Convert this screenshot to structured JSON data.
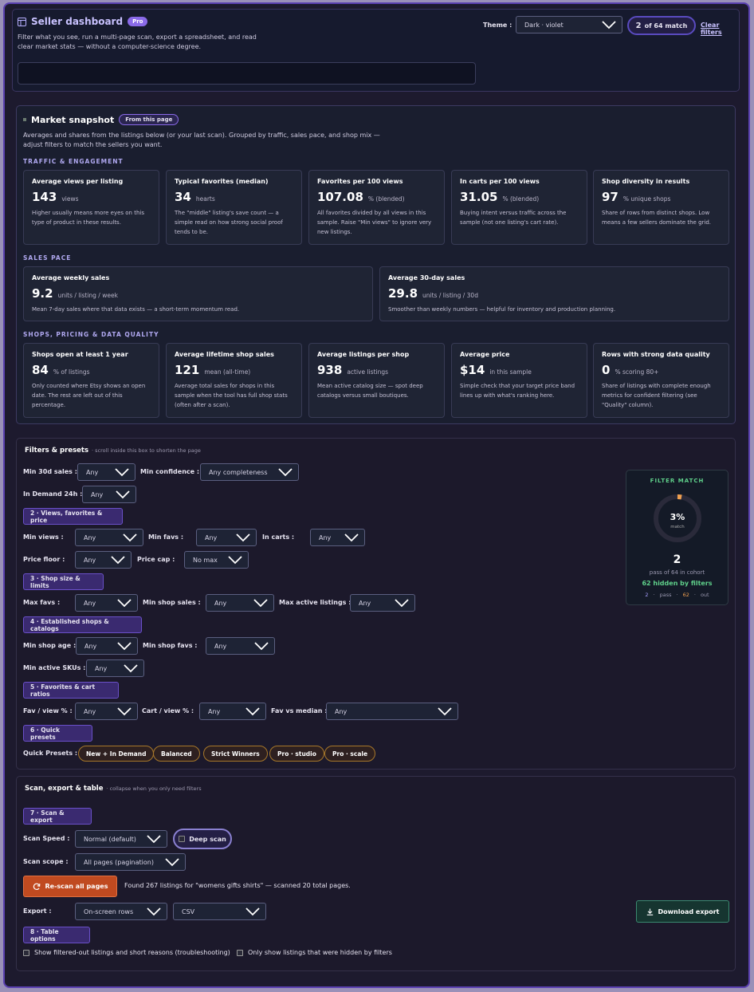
{
  "header": {
    "title": "Seller dashboard",
    "pro": "Pro",
    "subtitle": "Filter what you see, run a multi-page scan, export a spreadsheet, and read clear market stats — without a computer-science degree.",
    "theme_label": "Theme :",
    "theme_value": "Dark · violet",
    "match_count": "2",
    "match_text": "of 64 match",
    "clear_filters": "Clear filters"
  },
  "snapshot": {
    "title": "Market snapshot",
    "badge": "From this page",
    "subtitle": "Averages and shares from the listings below (or your last scan). Grouped by traffic, sales pace, and shop mix — adjust filters to match the sellers you want.",
    "sections": [
      "TRAFFIC & ENGAGEMENT",
      "SALES PACE",
      "SHOPS, PRICING & DATA QUALITY"
    ],
    "traffic": [
      {
        "title": "Average views per listing",
        "value": "143",
        "unit": "views",
        "desc": "Higher usually means more eyes on this type of product in these results."
      },
      {
        "title": "Typical favorites (median)",
        "value": "34",
        "unit": "hearts",
        "desc": "The \"middle\" listing's save count — a simple read on how strong social proof tends to be."
      },
      {
        "title": "Favorites per 100 views",
        "value": "107.08",
        "unit": "% (blended)",
        "desc": "All favorites divided by all views in this sample. Raise \"Min views\" to ignore very new listings."
      },
      {
        "title": "In carts per 100 views",
        "value": "31.05",
        "unit": "% (blended)",
        "desc": "Buying intent versus traffic across the sample (not one listing's cart rate)."
      },
      {
        "title": "Shop diversity in results",
        "value": "97",
        "unit": "% unique shops",
        "desc": "Share of rows from distinct shops. Low means a few sellers dominate the grid."
      }
    ],
    "sales": [
      {
        "title": "Average weekly sales",
        "value": "9.2",
        "unit": "units / listing / week",
        "desc": "Mean 7-day sales where that data exists — a short-term momentum read."
      },
      {
        "title": "Average 30-day sales",
        "value": "29.8",
        "unit": "units / listing / 30d",
        "desc": "Smoother than weekly numbers — helpful for inventory and production planning."
      }
    ],
    "shops": [
      {
        "title": "Shops open at least 1 year",
        "value": "84",
        "unit": "% of listings",
        "desc": "Only counted where Etsy shows an open date. The rest are left out of this percentage."
      },
      {
        "title": "Average lifetime shop sales",
        "value": "121",
        "unit": "mean (all-time)",
        "desc": "Average total sales for shops in this sample when the tool has full shop stats (often after a scan)."
      },
      {
        "title": "Average listings per shop",
        "value": "938",
        "unit": "active listings",
        "desc": "Mean active catalog size — spot deep catalogs versus small boutiques."
      },
      {
        "title": "Average price",
        "value": "$14",
        "unit": "in this sample",
        "desc": "Simple check that your target price band lines up with what's ranking here."
      },
      {
        "title": "Rows with strong data quality",
        "value": "0",
        "unit": "% scoring 80+",
        "desc": "Share of listings with complete enough metrics for confident filtering (see \"Quality\" column)."
      }
    ]
  },
  "filters": {
    "title": "Filters & presets",
    "hint": "· scroll inside this box to shorten the page",
    "min30": "Min 30d sales :",
    "min30_v": "Any",
    "minconf": "Min confidence :",
    "minconf_v": "Any completeness",
    "demand": "In Demand 24h :",
    "demand_v": "Any",
    "s2": "2 · Views, favorites & price",
    "minviews": "Min views :",
    "minviews_v": "Any",
    "minfavs": "Min favs :",
    "minfavs_v": "Any",
    "incarts": "In carts :",
    "incarts_v": "Any",
    "pfloor": "Price floor :",
    "pfloor_v": "Any",
    "pcap": "Price cap :",
    "pcap_v": "No max",
    "s3": "3 · Shop size & limits",
    "maxfavs": "Max favs :",
    "maxfavs_v": "Any",
    "minshopsales": "Min shop sales :",
    "minshopsales_v": "Any",
    "maxactive": "Max active listings :",
    "maxactive_v": "Any",
    "s4": "4 · Established shops & catalogs",
    "minage": "Min shop age :",
    "minage_v": "Any",
    "minshopfavs": "Min shop favs :",
    "minshopfavs_v": "Any",
    "minskus": "Min active SKUs :",
    "minskus_v": "Any",
    "s5": "5 · Favorites & cart ratios",
    "favview": "Fav / view % :",
    "favview_v": "Any",
    "cartview": "Cart / view % :",
    "cartview_v": "Any",
    "favmed": "Fav vs median :",
    "favmed_v": "Any",
    "s6": "6 · Quick presets",
    "qp_label": "Quick Presets :",
    "presets": [
      "New + In Demand",
      "Balanced",
      "Strict Winners",
      "Pro · studio",
      "Pro · scale"
    ]
  },
  "filter_match": {
    "title": "FILTER MATCH",
    "percent_label": "3%",
    "match_word": "match",
    "percent": 3,
    "count": "2",
    "cohort": "pass of 64 in cohort",
    "hidden": "62 hidden by filters",
    "pass_n": "2",
    "pass": "pass",
    "out_n": "62",
    "out": "out",
    "colors": {
      "ring": "#f0a050",
      "track": "#2a2a3a"
    }
  },
  "scan": {
    "title": "Scan, export & table",
    "hint": "· collapse when you only need filters",
    "s7": "7 · Scan & export",
    "speed": "Scan Speed :",
    "speed_v": "Normal (default)",
    "deep": "Deep scan",
    "scope": "Scan scope :",
    "scope_v": "All pages (pagination)",
    "rescan": "Re-scan all pages",
    "found": "Found 267 listings for \"womens gifts shirts\" — scanned 20 total pages.",
    "export": "Export :",
    "export_v": "On-screen rows",
    "format_v": "CSV",
    "download": "Download export",
    "s8": "8 · Table options",
    "chk1": "Show filtered-out listings and short reasons (troubleshooting)",
    "chk2": "Only show listings that were hidden by filters"
  }
}
